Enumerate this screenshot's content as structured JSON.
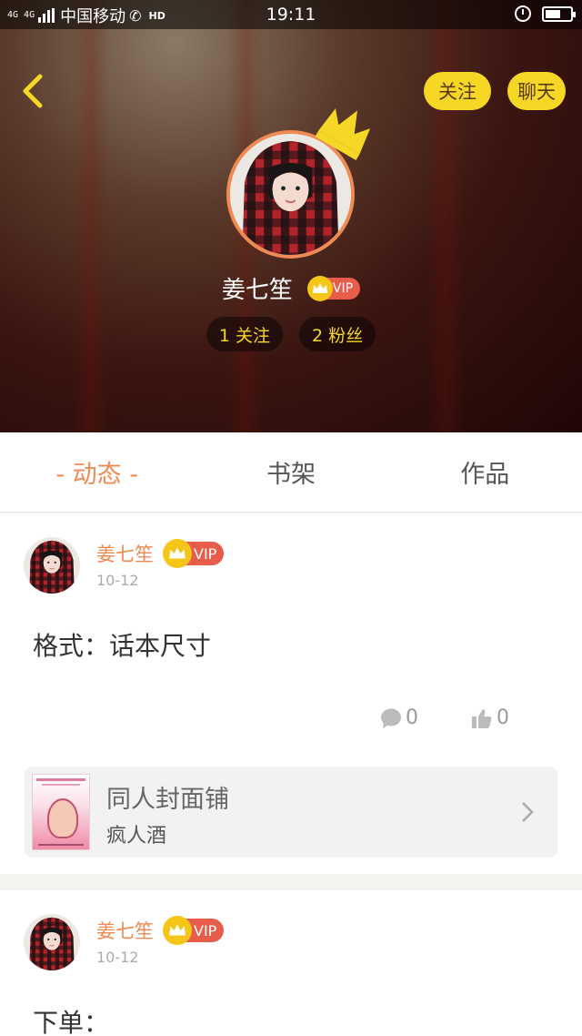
{
  "status_bar": {
    "signal": "4G 4G",
    "carrier": "中国移动",
    "hd": "HD",
    "time": "19:11"
  },
  "header": {
    "follow_label": "关注",
    "chat_label": "聊天",
    "user_name": "姜七笙",
    "vip_label": "VIP",
    "following": "1 关注",
    "followers": "2 粉丝"
  },
  "tabs": [
    {
      "label": "- 动态 -",
      "active": true
    },
    {
      "label": "书架",
      "active": false
    },
    {
      "label": "作品",
      "active": false
    }
  ],
  "posts": [
    {
      "author": "姜七笙",
      "vip_label": "VIP",
      "date": "10-12",
      "text": "格式：话本尺寸",
      "comment_count": "0",
      "like_count": "0",
      "card_title": "同人封面铺",
      "card_subtitle": "疯人酒"
    },
    {
      "author": "姜七笙",
      "vip_label": "VIP",
      "date": "10-12",
      "text": "下单："
    }
  ],
  "colors": {
    "accent_orange": "#ee8a53",
    "yellow_button": "#f7d726",
    "vip_red": "#e85c4a"
  },
  "icons": [
    "back-chevron-icon",
    "crown-icon",
    "comment-icon",
    "thumbs-up-icon",
    "chevron-right-icon",
    "alarm-icon",
    "battery-icon"
  ]
}
